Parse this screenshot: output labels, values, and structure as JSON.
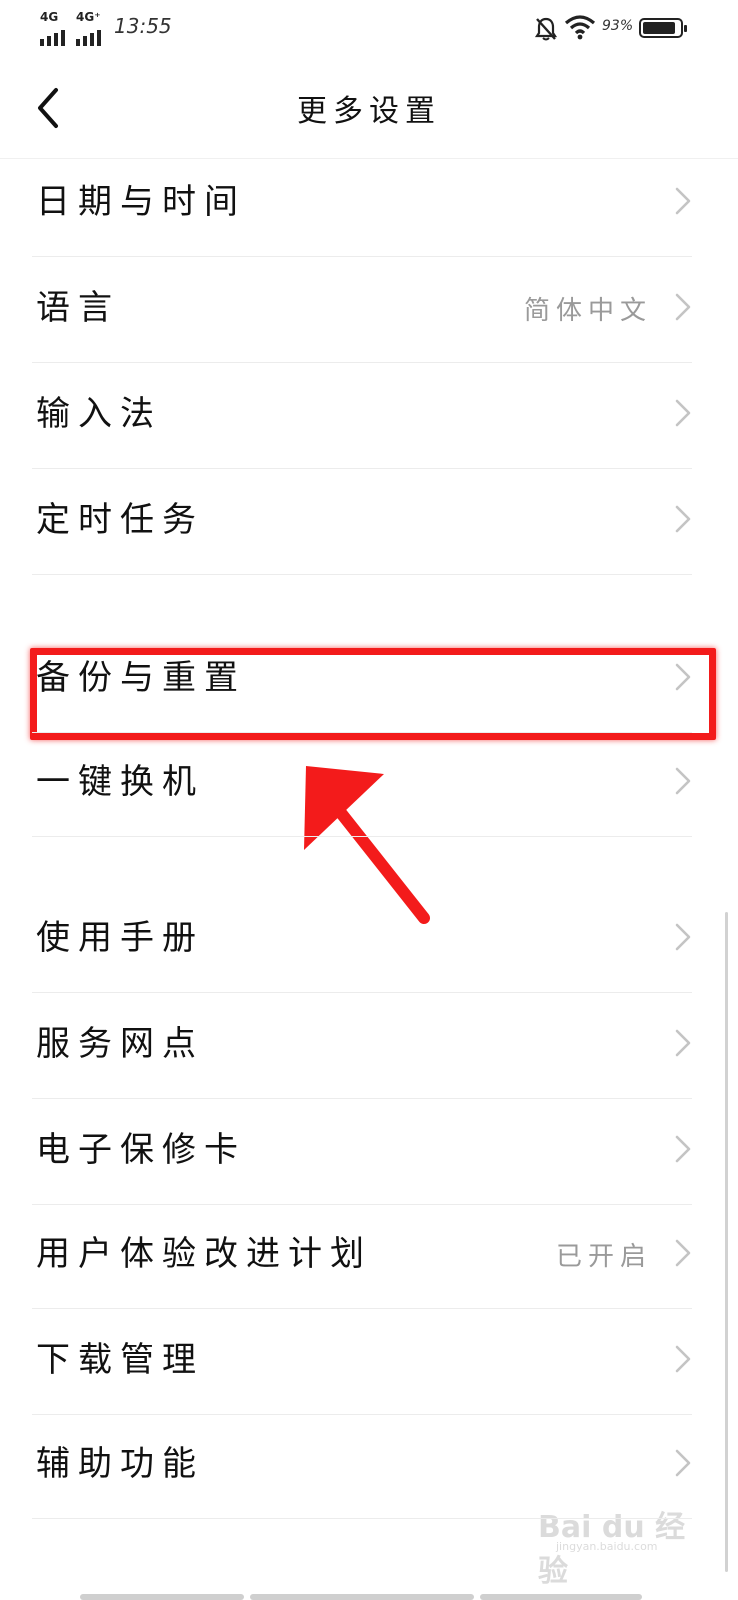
{
  "status_bar": {
    "signal_1_label": "4G",
    "signal_2_label": "4G⁺",
    "time": "13:55",
    "battery_percent": "93%",
    "battery_level": 0.93,
    "icons": [
      "bell-muted-icon",
      "wifi-icon",
      "battery-icon"
    ]
  },
  "header": {
    "title": "更多设置",
    "back_icon": "chevron-left-icon"
  },
  "settings": {
    "items": [
      {
        "label": "日期与时间",
        "value": ""
      },
      {
        "label": "语言",
        "value": "简体中文"
      },
      {
        "label": "输入法",
        "value": ""
      },
      {
        "label": "定时任务",
        "value": ""
      },
      {
        "label": "备份与重置",
        "value": ""
      },
      {
        "label": "一键换机",
        "value": ""
      },
      {
        "label": "使用手册",
        "value": ""
      },
      {
        "label": "服务网点",
        "value": ""
      },
      {
        "label": "电子保修卡",
        "value": ""
      },
      {
        "label": "用户体验改进计划",
        "value": "已开启"
      },
      {
        "label": "下载管理",
        "value": ""
      },
      {
        "label": "辅助功能",
        "value": ""
      }
    ]
  },
  "annotation": {
    "highlighted_item": "备份与重置",
    "color": "#f31b1b"
  },
  "watermark": {
    "logo": "Bai du 经验",
    "url": "jingyan.baidu.com"
  }
}
